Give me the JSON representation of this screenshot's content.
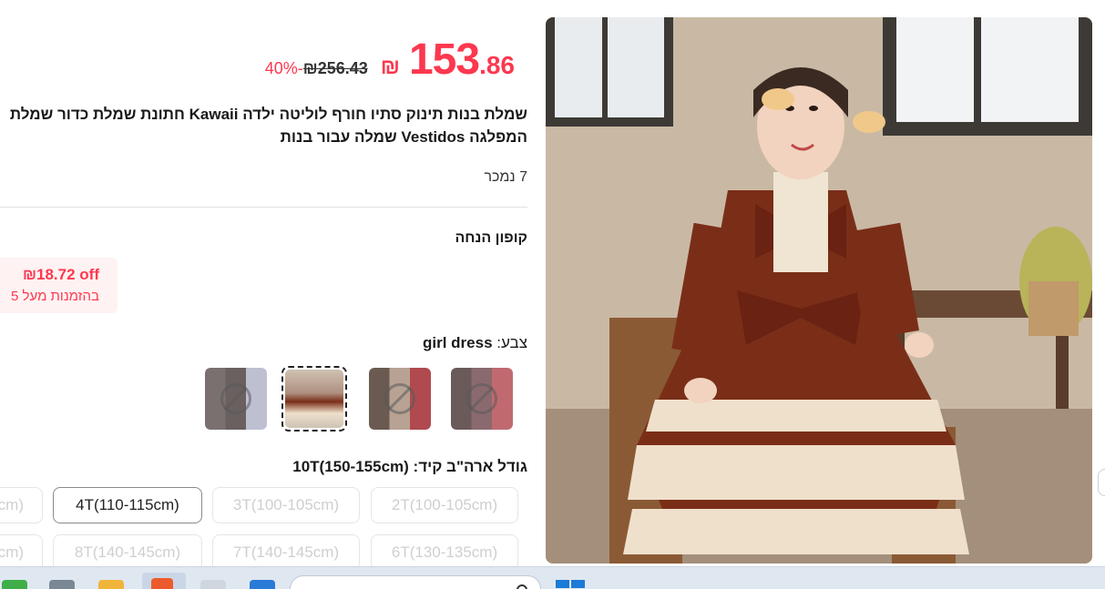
{
  "price": {
    "currency_symbol": "₪",
    "current_int": "153",
    "current_dec": ".86",
    "original": "₪256.43",
    "discount": "40%-"
  },
  "product": {
    "title_line1": "שמלת בנות תינוק סתיו חורף לוליטה ילדה Kawaii חתונת שמלת כדור שמלת",
    "title_line2": "המפלגה Vestidos שמלה עבור בנות",
    "sold": "7 נמכר"
  },
  "coupon": {
    "label": "קופון הנחה",
    "amount": "₪18.72 off",
    "condition": "בהזמנות מעל 5"
  },
  "color": {
    "label": "צבע:",
    "selected_value": "girl dress"
  },
  "size": {
    "label": "גודל ארה\"ב קיד: 10T(150-155cm)",
    "row1": [
      "2T(100-105cm)",
      "3T(100-105cm)",
      "4T(110-115cm)",
      "cm)"
    ],
    "row2": [
      "6T(130-135cm)",
      "7T(140-145cm)",
      "8T(140-145cm)",
      "cm)"
    ]
  },
  "colors": {
    "accent": "#fd384f",
    "coupon_bg": "#fff2f2"
  },
  "icons": {
    "unavailable": "ban-icon",
    "search": "search-icon"
  }
}
